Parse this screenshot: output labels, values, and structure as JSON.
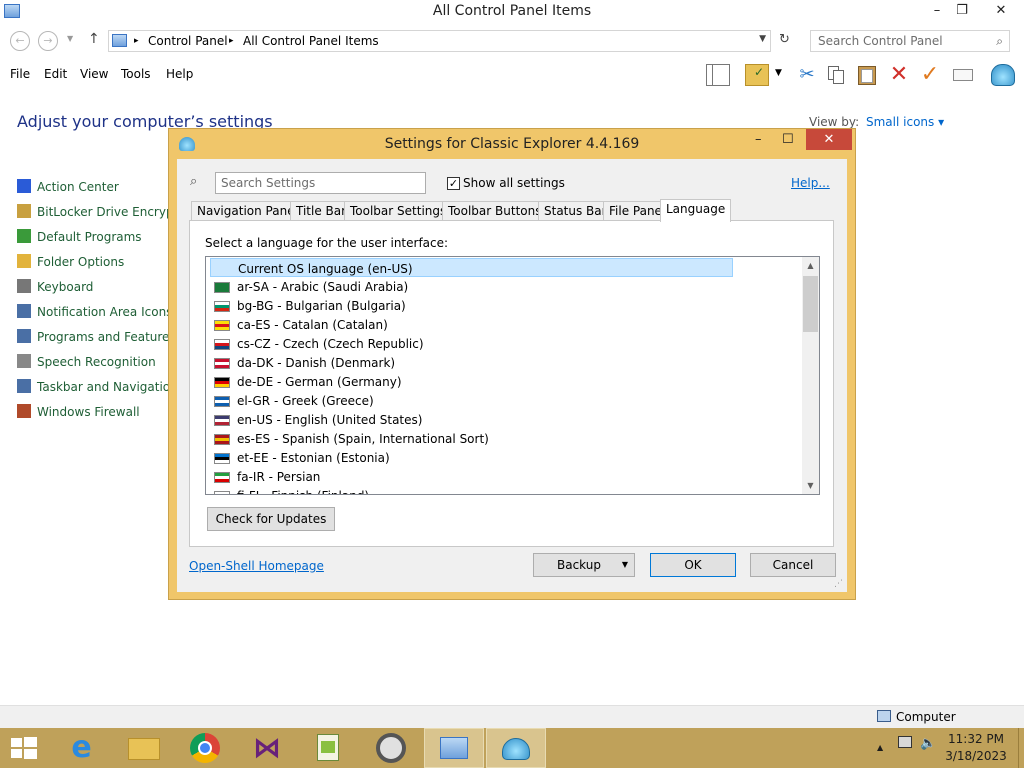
{
  "explorer": {
    "title": "All Control Panel Items",
    "window_buttons": {
      "minimize": "–",
      "maximize": "❐",
      "close": "✕"
    },
    "address": {
      "crumbs": [
        "Control Panel",
        "All Control Panel Items"
      ],
      "separator": "▸"
    },
    "search_placeholder": "Search Control Panel",
    "menu": [
      "File",
      "Edit",
      "View",
      "Tools",
      "Help"
    ],
    "heading": "Adjust your computer’s settings",
    "view_by_label": "View by:",
    "view_by_value": "Small icons ▾",
    "items": [
      {
        "label": "Action Center",
        "icon": "flag-icon",
        "color": "#2a5bd7"
      },
      {
        "label": "BitLocker Drive Encryptio",
        "icon": "bitlocker-icon",
        "color": "#c8a040"
      },
      {
        "label": "Default Programs",
        "icon": "default-programs-icon",
        "color": "#3a9a3a"
      },
      {
        "label": "Folder Options",
        "icon": "folder-icon",
        "color": "#e2b33c"
      },
      {
        "label": "Keyboard",
        "icon": "keyboard-icon",
        "color": "#777777"
      },
      {
        "label": "Notification Area Icons",
        "icon": "notification-area-icon",
        "color": "#4a6fa5"
      },
      {
        "label": "Programs and Features",
        "icon": "programs-icon",
        "color": "#4a6fa5"
      },
      {
        "label": "Speech Recognition",
        "icon": "microphone-icon",
        "color": "#888888"
      },
      {
        "label": "Taskbar and Navigation",
        "icon": "taskbar-icon",
        "color": "#4a6fa5"
      },
      {
        "label": "Windows Firewall",
        "icon": "firewall-icon",
        "color": "#b04a2a"
      }
    ],
    "status_computer": "Computer"
  },
  "dialog": {
    "title": "Settings for Classic Explorer 4.4.169",
    "close_glyph": "✕",
    "min_glyph": "–",
    "max_glyph": "☐",
    "search_placeholder": "Search Settings",
    "show_all_checked": true,
    "check_mark": "✓",
    "show_all_label": "Show all settings",
    "help_link": "Help...",
    "tabs": [
      "Navigation Pane",
      "Title Bar",
      "Toolbar Settings",
      "Toolbar Buttons",
      "Status Bar",
      "File Pane",
      "Language"
    ],
    "active_tab": "Language",
    "panel_label": "Select a language for the user interface:",
    "languages": [
      {
        "label": "Current OS language (en-US)",
        "selected": true,
        "flag": null
      },
      {
        "label": "ar-SA - Arabic (Saudi Arabia)",
        "flag": [
          "#1a7a3a",
          "#1a7a3a",
          "#1a7a3a"
        ]
      },
      {
        "label": "bg-BG - Bulgarian (Bulgaria)",
        "flag": [
          "#ffffff",
          "#00966e",
          "#d62612"
        ]
      },
      {
        "label": "ca-ES - Catalan (Catalan)",
        "flag": [
          "#fcdd09",
          "#da121a",
          "#fcdd09"
        ]
      },
      {
        "label": "cs-CZ - Czech (Czech Republic)",
        "flag": [
          "#ffffff",
          "#d7141a",
          "#11457e"
        ]
      },
      {
        "label": "da-DK - Danish (Denmark)",
        "flag": [
          "#c8102e",
          "#ffffff",
          "#c8102e"
        ]
      },
      {
        "label": "de-DE - German (Germany)",
        "flag": [
          "#000000",
          "#dd0000",
          "#ffce00"
        ]
      },
      {
        "label": "el-GR - Greek (Greece)",
        "flag": [
          "#0d5eaf",
          "#ffffff",
          "#0d5eaf"
        ]
      },
      {
        "label": "en-US - English (United States)",
        "flag": [
          "#3c3b6e",
          "#ffffff",
          "#b22234"
        ]
      },
      {
        "label": "es-ES - Spanish (Spain, International Sort)",
        "flag": [
          "#aa151b",
          "#f1bf00",
          "#aa151b"
        ]
      },
      {
        "label": "et-EE - Estonian (Estonia)",
        "flag": [
          "#0072ce",
          "#000000",
          "#ffffff"
        ]
      },
      {
        "label": "fa-IR - Persian",
        "flag": [
          "#239f40",
          "#ffffff",
          "#da0000"
        ]
      },
      {
        "label": "fi-FI - Finnish (Finland)",
        "flag": [
          "#ffffff",
          "#002f6c",
          "#ffffff"
        ]
      }
    ],
    "check_updates": "Check for Updates",
    "homepage_link": "Open-Shell Homepage",
    "backup_button": "Backup",
    "backup_arrow": "▼",
    "ok_button": "OK",
    "cancel_button": "Cancel"
  },
  "taskbar": {
    "time": "11:32 PM",
    "date": "3/18/2023",
    "tray_up": "▲",
    "colors": {
      "bar": "#bfa15a",
      "active": "#d9c48e"
    }
  }
}
